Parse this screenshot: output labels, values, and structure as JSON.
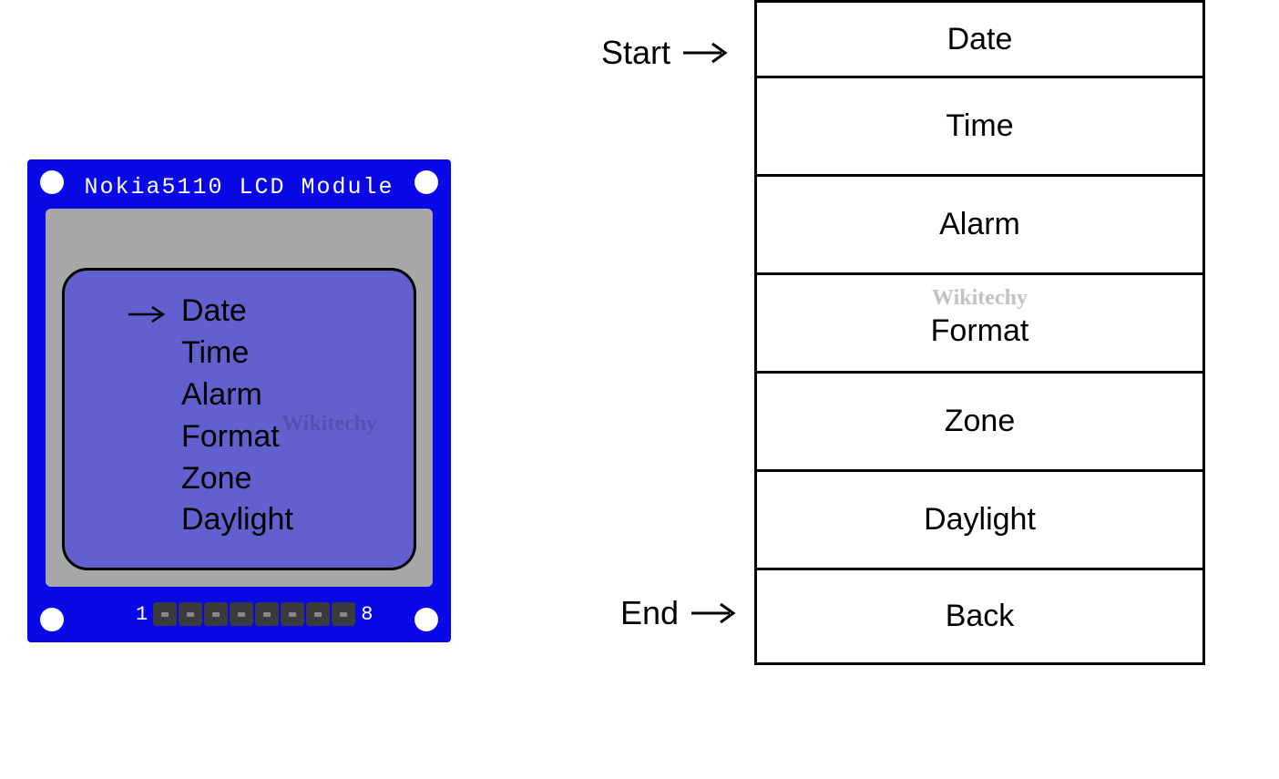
{
  "lcd": {
    "title": "Nokia5110 LCD Module",
    "pin_start": "1",
    "pin_end": "8",
    "menu_items": [
      "Date",
      "Time",
      "Alarm",
      "Format",
      "Zone",
      "Daylight"
    ]
  },
  "pointers": {
    "start": "Start",
    "end": "End"
  },
  "table": {
    "items": [
      "Date",
      "Time",
      "Alarm",
      "Format",
      "Zone",
      "Daylight",
      "Back"
    ]
  },
  "watermark": "Wikitechy"
}
